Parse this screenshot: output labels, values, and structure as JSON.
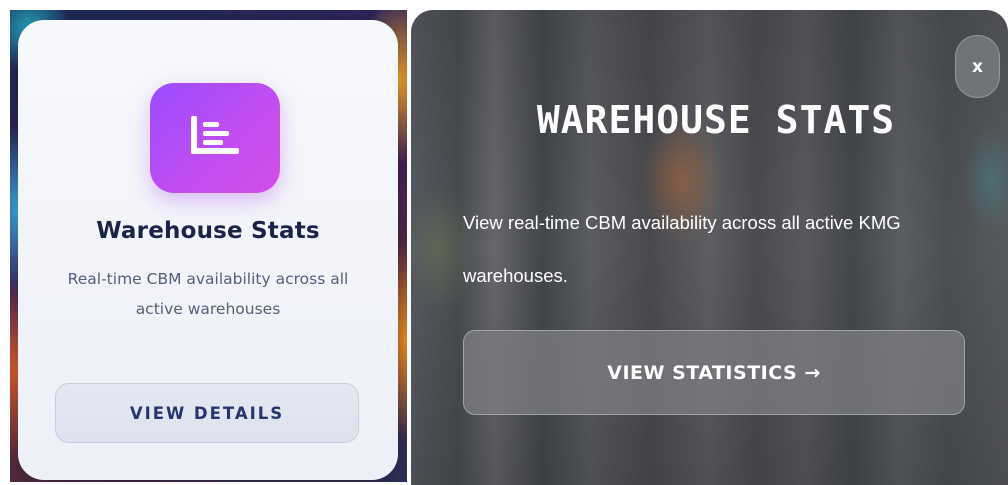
{
  "left_card": {
    "icon": "bar-chart-list-icon",
    "title": "Warehouse Stats",
    "description": "Real-time CBM availability across all active warehouses",
    "button_label": "VIEW DETAILS"
  },
  "right_modal": {
    "close_label": "x",
    "title": "WAREHOUSE STATS",
    "description": "View real-time CBM availability across all active KMG warehouses.",
    "button_label": "VIEW STATISTICS →"
  },
  "colors": {
    "icon_gradient_start": "#9a4cff",
    "icon_gradient_end": "#d04fe8",
    "left_title": "#1a2448",
    "left_button_text": "#27356e",
    "right_text": "#ffffff"
  }
}
